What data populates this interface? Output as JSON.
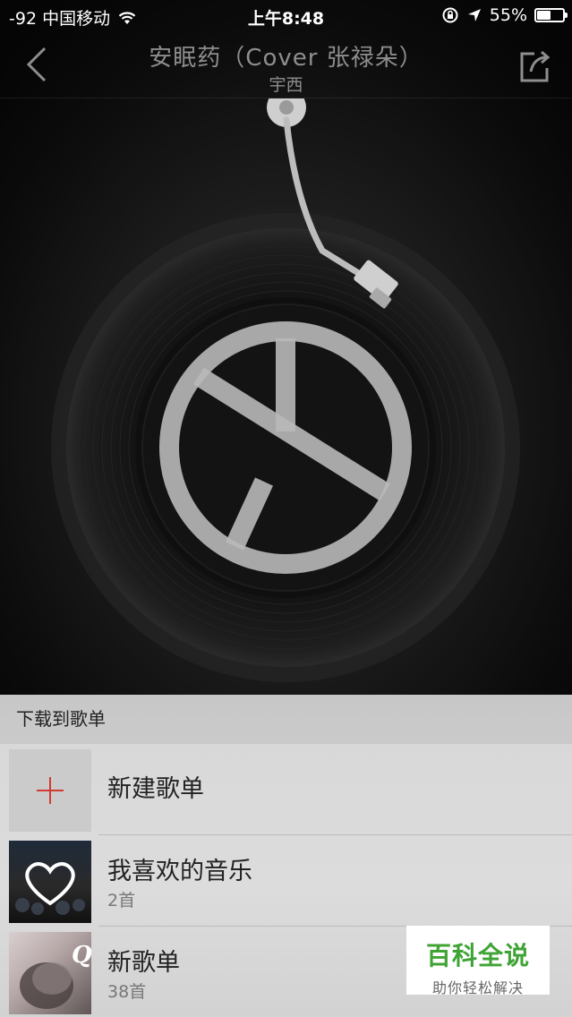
{
  "status_bar": {
    "carrier": "-92 中国移动",
    "time": "上午8:48",
    "battery_percent": "55%",
    "battery_level": 0.55
  },
  "nav": {
    "title": "安眠药（Cover  张禄朵）",
    "artist": "宇西",
    "back_icon": "chevron-left-icon",
    "share_icon": "share-icon"
  },
  "sheet": {
    "header": "下载到歌单",
    "playlists": [
      {
        "name": "新建歌单",
        "count": "",
        "icon": "plus-icon"
      },
      {
        "name": "我喜欢的音乐",
        "count": "2首",
        "icon": "heart-icon"
      },
      {
        "name": "新歌单",
        "count": "38首",
        "icon": "album-cover"
      }
    ]
  },
  "watermark": {
    "title": "百科全说",
    "subtitle": "助你轻松解决"
  },
  "colors": {
    "plus_accent": "#d33a31",
    "watermark_green": "#3fa335"
  }
}
